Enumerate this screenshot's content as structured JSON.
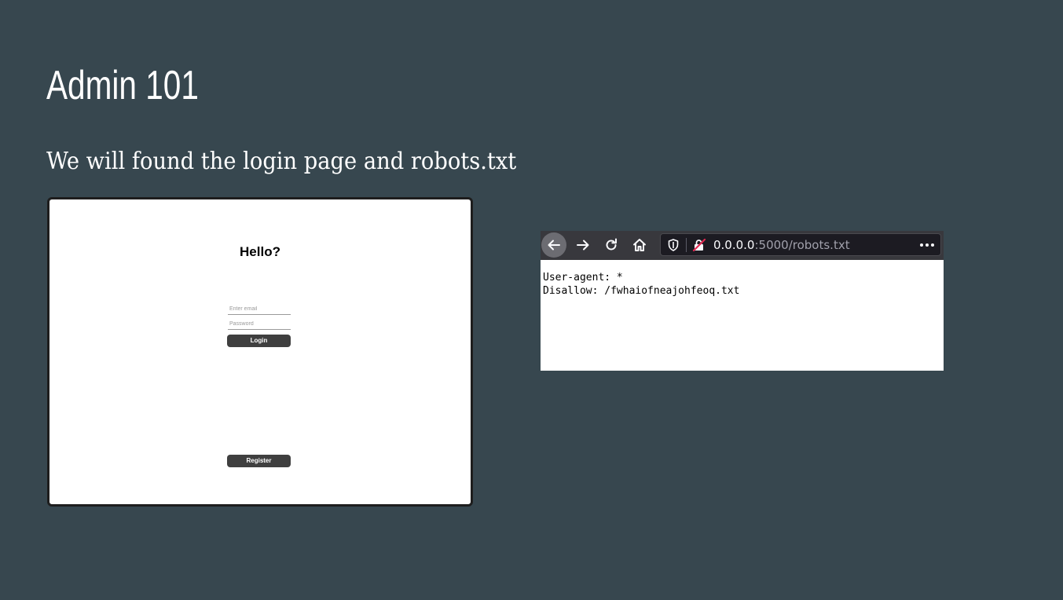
{
  "slide": {
    "title": "Admin 101",
    "subtitle": "We will found the login page and robots.txt",
    "background_color": "#37474f"
  },
  "login_page": {
    "heading": "Hello?",
    "email_placeholder": "Enter email",
    "password_placeholder": "Password",
    "login_label": "Login",
    "register_label": "Register",
    "button_color": "#3f3f3f"
  },
  "browser": {
    "url_host": "0.0.0.0",
    "url_path": ":5000/robots.txt",
    "icons": {
      "back": "back-arrow-icon",
      "forward": "forward-arrow-icon",
      "reload": "reload-icon",
      "home": "home-icon",
      "tracking": "shield-icon",
      "insecure": "insecure-connection-icon",
      "menu": "more-dots-icon"
    },
    "toolbar_color": "#38383d",
    "content": {
      "line1": "User-agent: *",
      "line2": "Disallow: /fwhaiofneajohfeoq.txt"
    }
  }
}
